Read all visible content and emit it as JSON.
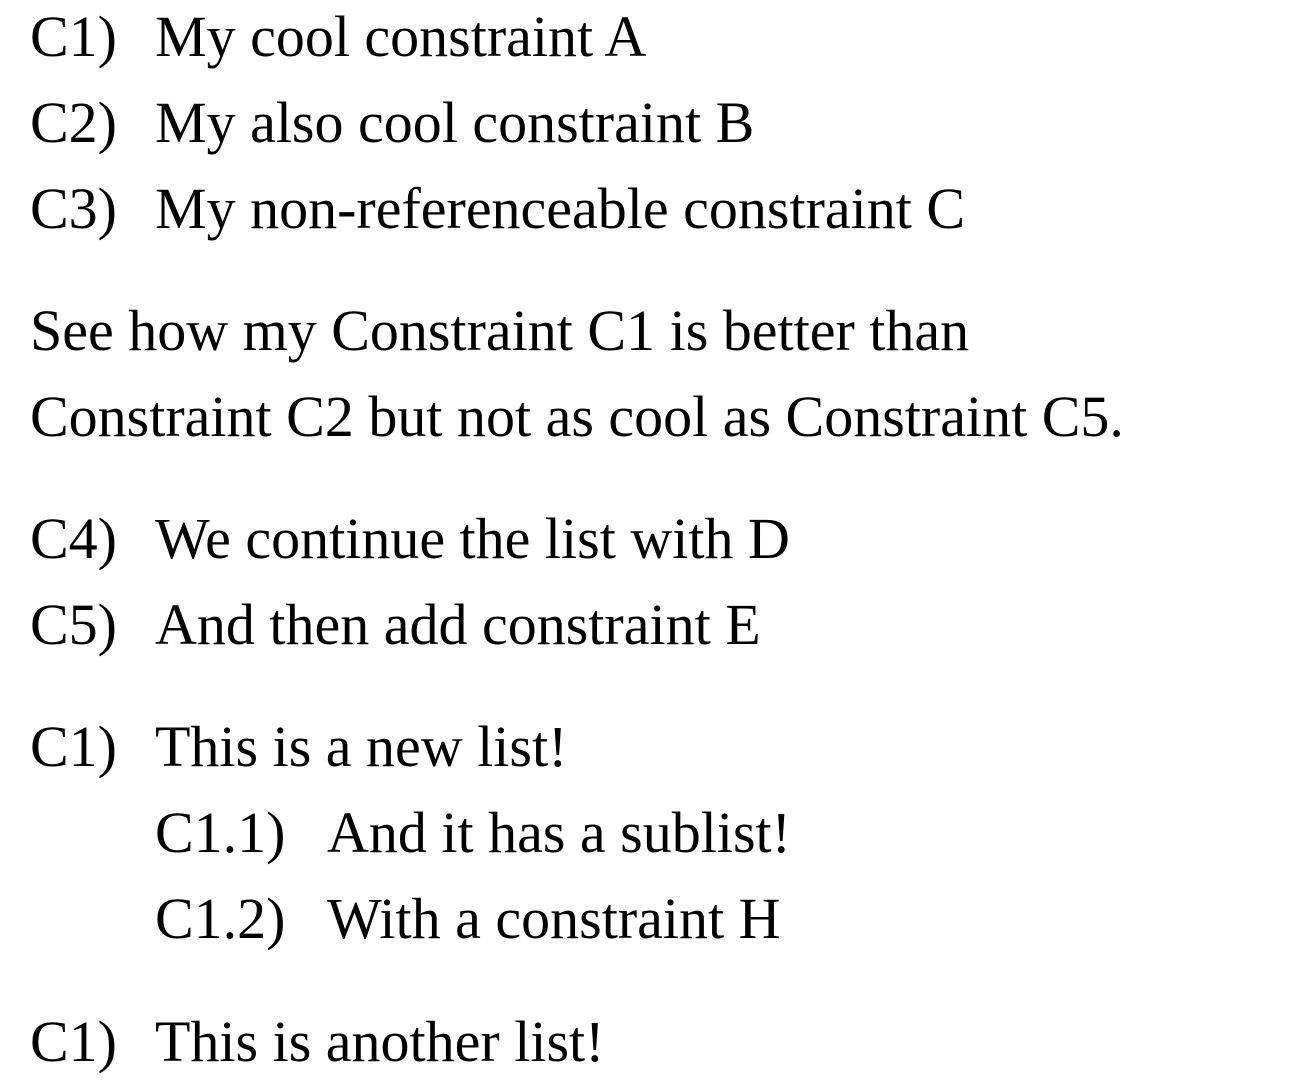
{
  "list1": {
    "items": [
      {
        "marker": "C1)",
        "text": "My cool constraint A"
      },
      {
        "marker": "C2)",
        "text": "My also cool constraint B"
      },
      {
        "marker": "C3)",
        "text": "My non-referenceable constraint C"
      }
    ]
  },
  "paragraph": {
    "lines": [
      "See how my Constraint C1 is better than",
      "Constraint C2 but not as cool as Constraint C5."
    ]
  },
  "list1_continued": {
    "items": [
      {
        "marker": "C4)",
        "text": "We continue the list with D"
      },
      {
        "marker": "C5)",
        "text": "And then add constraint E"
      }
    ]
  },
  "list2": {
    "items": [
      {
        "marker": "C1)",
        "text": "This is a new list!"
      }
    ],
    "sublist": [
      {
        "marker": "C1.1)",
        "text": "And it has a sublist!"
      },
      {
        "marker": "C1.2)",
        "text": "With a constraint H"
      }
    ]
  },
  "list3": {
    "items": [
      {
        "marker": "C1)",
        "text": "This is another list!"
      }
    ]
  }
}
